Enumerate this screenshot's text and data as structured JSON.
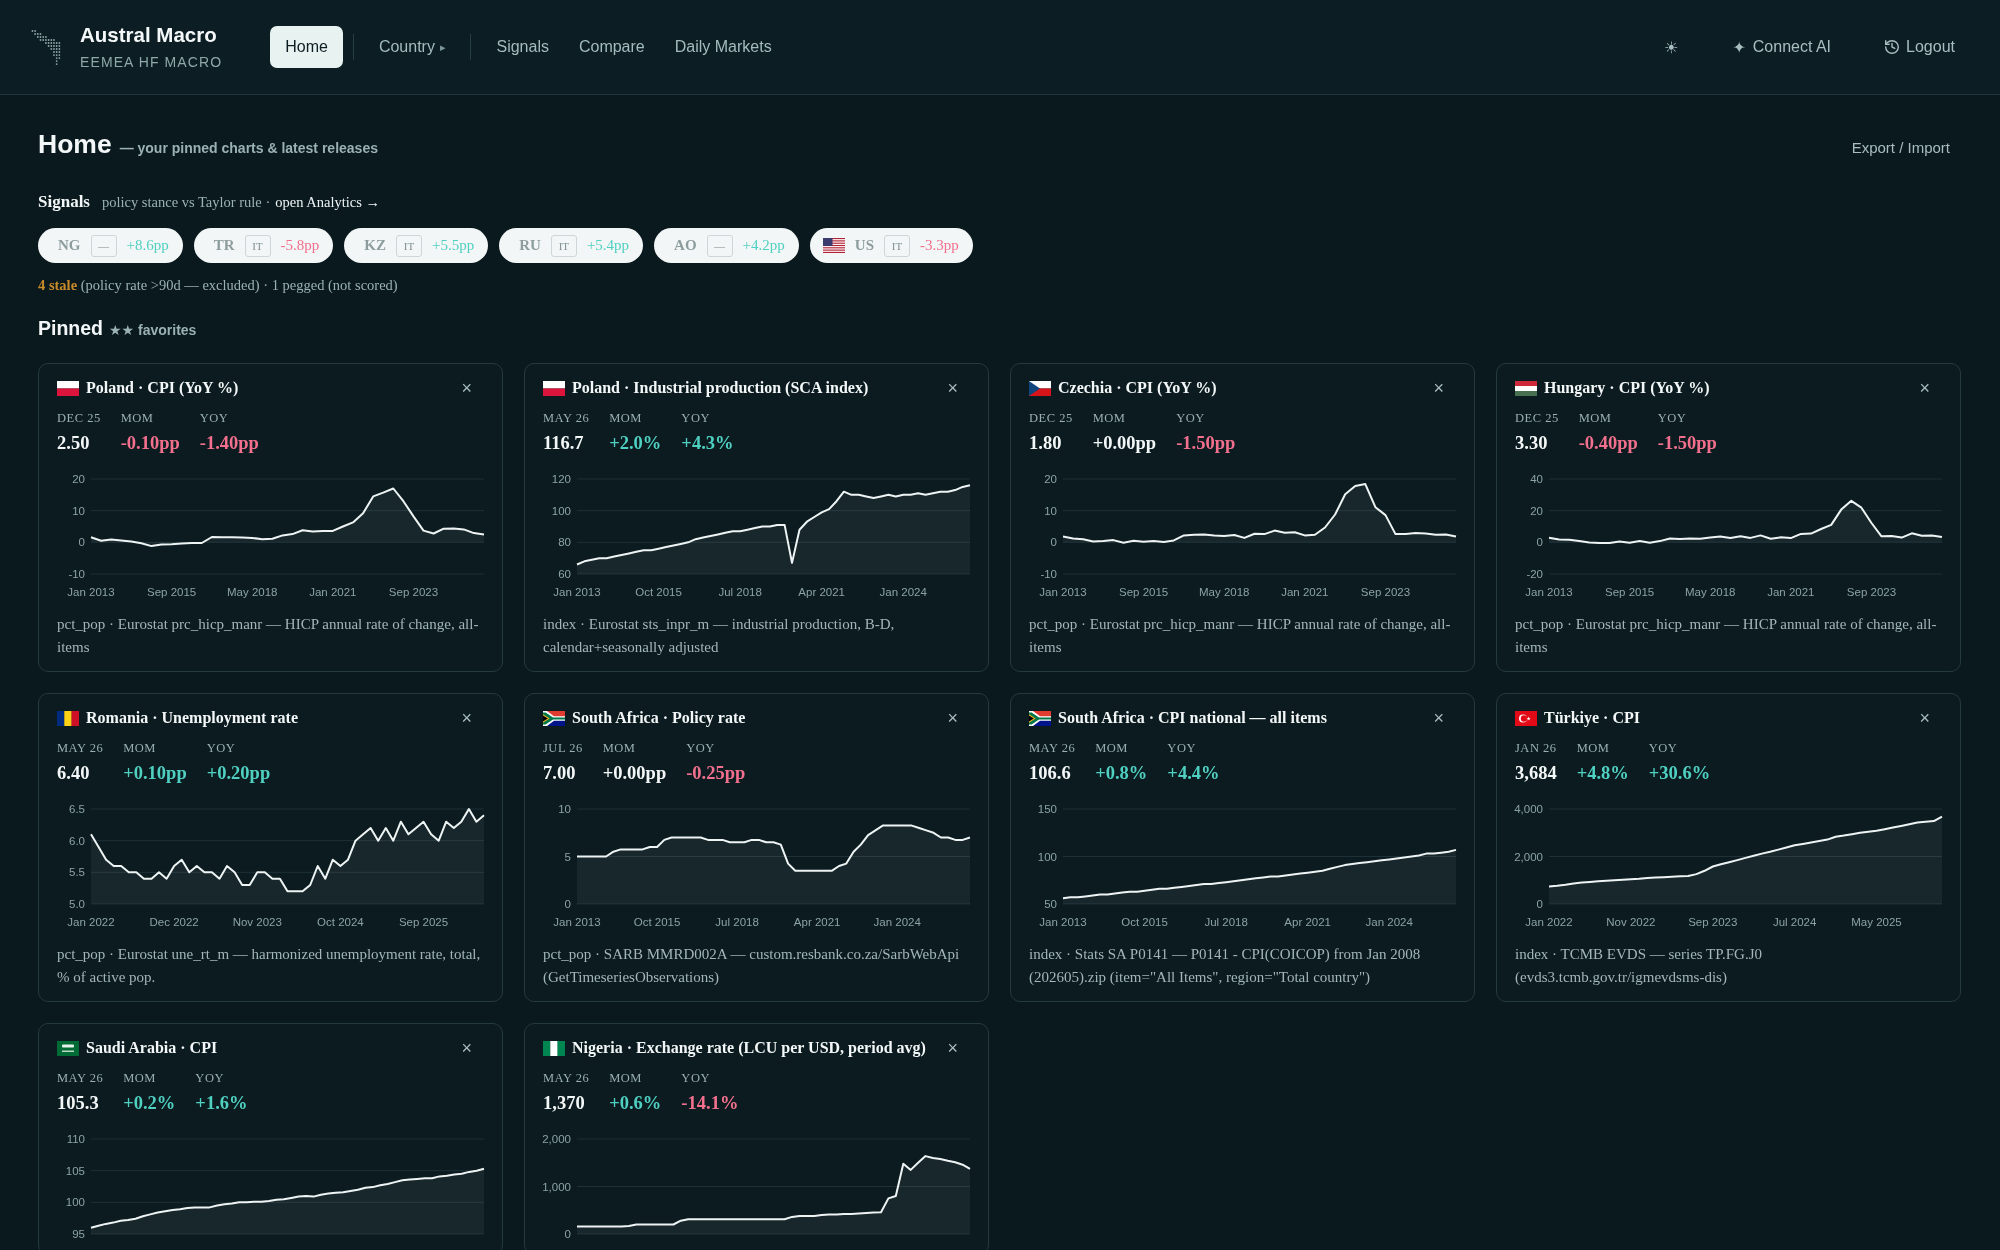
{
  "header": {
    "brand": {
      "title": "Austral Macro",
      "subtitle": "EEMEA HF MACRO"
    },
    "nav": [
      {
        "label": "Home",
        "selected": true,
        "divider": true
      },
      {
        "label": "Country",
        "caret": "▸",
        "selected": false,
        "divider": true
      },
      {
        "label": "Signals",
        "selected": false,
        "divider": false
      },
      {
        "label": "Compare",
        "selected": false,
        "divider": false
      },
      {
        "label": "Daily Markets",
        "selected": false,
        "divider": false
      }
    ],
    "actions": [
      {
        "kind": "theme",
        "glyph": "☀"
      },
      {
        "kind": "connect",
        "glyph": "✦",
        "label": "Connect AI"
      },
      {
        "kind": "logout",
        "label": "Logout"
      }
    ]
  },
  "page": {
    "title": "Home",
    "subtitle": "— your pinned charts & latest releases",
    "action": "Export / Import"
  },
  "signals": {
    "title": "Signals",
    "description": "policy stance vs Taylor rule ·",
    "link": "open Analytics →",
    "pills": [
      {
        "code": "NG",
        "regime": "—",
        "value": "+8.6pp",
        "color": "#4fd0c1"
      },
      {
        "code": "TR",
        "regime": "IT",
        "value": "-5.8pp",
        "color": "#f2708d"
      },
      {
        "code": "KZ",
        "regime": "IT",
        "value": "+5.5pp",
        "color": "#4fd0c1"
      },
      {
        "code": "RU",
        "regime": "IT",
        "value": "+5.4pp",
        "color": "#4fd0c1"
      },
      {
        "code": "AO",
        "regime": "—",
        "value": "+4.2pp",
        "color": "#4fd0c1"
      },
      {
        "flag": {
          "kind": "us"
        },
        "code": "US",
        "regime": "IT",
        "value": "-3.3pp",
        "color": "#f2708d"
      }
    ],
    "note": {
      "stale": "4 stale",
      "text": "(policy rate >90d — excluded) · 1 pegged (not scored)"
    }
  },
  "pinned": {
    "title": "Pinned",
    "subtitle": "★★ favorites"
  },
  "cards": [
    {
      "flag": {
        "kind": "pl"
      },
      "title": "Poland · CPI (YoY %)",
      "close": "×",
      "stats": [
        {
          "label": "DEC 25",
          "value": "2.50",
          "color": "#f3f7f7"
        },
        {
          "label": "MOM",
          "value": "-0.10pp",
          "color": "#f2708d"
        },
        {
          "label": "YOY",
          "value": "-1.40pp",
          "color": "#f2708d"
        }
      ],
      "chart_data": {
        "type": "area",
        "ylim": [
          -10,
          20
        ],
        "yticks": [
          -10,
          0,
          10,
          20
        ],
        "categories": [
          "Jan 2013",
          null,
          null,
          null,
          null,
          null,
          null,
          null,
          "Sep 2015",
          null,
          null,
          null,
          null,
          null,
          null,
          null,
          "May 2018",
          null,
          null,
          null,
          null,
          null,
          null,
          null,
          "Jan 2021",
          null,
          null,
          null,
          null,
          null,
          null,
          null,
          "Sep 2023",
          null,
          null,
          null,
          null,
          null,
          null,
          null
        ],
        "series": [
          {
            "color": "#eef4f4",
            "values": [
              1.6,
              0.5,
              0.9,
              0.6,
              0.3,
              -0.3,
              -1.2,
              -0.7,
              -0.6,
              -0.4,
              -0.2,
              -0.2,
              1.7,
              1.6,
              1.6,
              1.5,
              1.4,
              1.0,
              1.1,
              2.2,
              2.6,
              3.8,
              3.4,
              3.6,
              3.6,
              5.0,
              6.3,
              9.2,
              14.5,
              15.7,
              17.0,
              13.0,
              8.2,
              3.7,
              2.8,
              4.3,
              4.4,
              4.1,
              2.9,
              2.5
            ]
          }
        ]
      },
      "source": "pct_pop · Eurostat prc_hicp_manr — HICP annual rate of change, all-items"
    },
    {
      "flag": {
        "kind": "pl"
      },
      "title": "Poland · Industrial production (SCA index)",
      "close": "×",
      "stats": [
        {
          "label": "MAY 26",
          "value": "116.7",
          "color": "#f3f7f7"
        },
        {
          "label": "MOM",
          "value": "+2.0%",
          "color": "#4fd0c1"
        },
        {
          "label": "YOY",
          "value": "+4.3%",
          "color": "#4fd0c1"
        }
      ],
      "chart_data": {
        "type": "area",
        "ylim": [
          60,
          120
        ],
        "yticks": [
          60,
          80,
          100,
          120
        ],
        "categories": [
          "Jan 2013",
          null,
          null,
          null,
          null,
          null,
          null,
          null,
          null,
          null,
          null,
          "Oct 2015",
          null,
          null,
          null,
          null,
          null,
          null,
          null,
          null,
          null,
          null,
          "Jul 2018",
          null,
          null,
          null,
          null,
          null,
          null,
          null,
          null,
          null,
          null,
          "Apr 2021",
          null,
          null,
          null,
          null,
          null,
          null,
          null,
          null,
          null,
          null,
          "Jan 2024",
          null,
          null,
          null,
          null,
          null,
          null,
          null,
          null,
          null
        ],
        "series": [
          {
            "color": "#eef4f4",
            "values": [
              66,
              68,
              69,
              70,
              70,
              71,
              72,
              73,
              74,
              75,
              75,
              76,
              77,
              78,
              79,
              80,
              82,
              83,
              84,
              85,
              86,
              87,
              87,
              88,
              89,
              90,
              90,
              91,
              91,
              67,
              88,
              93,
              96,
              99,
              101,
              106,
              112,
              110,
              110,
              109,
              108,
              109,
              110,
              109,
              110,
              110,
              111,
              110,
              111,
              112,
              112,
              113,
              115,
              116
            ]
          }
        ]
      },
      "source": "index · Eurostat sts_inpr_m — industrial production, B-D, calendar+seasonally adjusted"
    },
    {
      "flag": {
        "kind": "cz"
      },
      "title": "Czechia · CPI (YoY %)",
      "close": "×",
      "stats": [
        {
          "label": "DEC 25",
          "value": "1.80",
          "color": "#f3f7f7"
        },
        {
          "label": "MOM",
          "value": "+0.00pp",
          "color": "#f3f7f7"
        },
        {
          "label": "YOY",
          "value": "-1.50pp",
          "color": "#f2708d"
        }
      ],
      "chart_data": {
        "type": "area",
        "ylim": [
          -10,
          20
        ],
        "yticks": [
          -10,
          0,
          10,
          20
        ],
        "categories": [
          "Jan 2013",
          null,
          null,
          null,
          null,
          null,
          null,
          null,
          "Sep 2015",
          null,
          null,
          null,
          null,
          null,
          null,
          null,
          "May 2018",
          null,
          null,
          null,
          null,
          null,
          null,
          null,
          "Jan 2021",
          null,
          null,
          null,
          null,
          null,
          null,
          null,
          "Sep 2023",
          null,
          null,
          null,
          null,
          null,
          null,
          null
        ],
        "series": [
          {
            "color": "#eef4f4",
            "values": [
              1.8,
              1.2,
              1.0,
              0.3,
              0.4,
              0.7,
              -0.1,
              0.5,
              0.2,
              0.4,
              0.1,
              0.6,
              2.2,
              2.4,
              2.5,
              2.2,
              2.0,
              2.3,
              1.4,
              2.7,
              2.6,
              3.7,
              3.0,
              3.2,
              2.2,
              2.4,
              4.7,
              8.8,
              15.2,
              17.8,
              18.4,
              11.1,
              8.6,
              2.6,
              2.6,
              2.9,
              2.8,
              2.4,
              2.5,
              1.8
            ]
          }
        ]
      },
      "source": "pct_pop · Eurostat prc_hicp_manr — HICP annual rate of change, all-items"
    },
    {
      "flag": {
        "kind": "hu"
      },
      "title": "Hungary · CPI (YoY %)",
      "close": "×",
      "stats": [
        {
          "label": "DEC 25",
          "value": "3.30",
          "color": "#f3f7f7"
        },
        {
          "label": "MOM",
          "value": "-0.40pp",
          "color": "#f2708d"
        },
        {
          "label": "YOY",
          "value": "-1.50pp",
          "color": "#f2708d"
        }
      ],
      "chart_data": {
        "type": "area",
        "ylim": [
          -20,
          40
        ],
        "yticks": [
          -20,
          0,
          20,
          40
        ],
        "categories": [
          "Jan 2013",
          null,
          null,
          null,
          null,
          null,
          null,
          null,
          "Sep 2015",
          null,
          null,
          null,
          null,
          null,
          null,
          null,
          "May 2018",
          null,
          null,
          null,
          null,
          null,
          null,
          null,
          "Jan 2021",
          null,
          null,
          null,
          null,
          null,
          null,
          null,
          "Sep 2023",
          null,
          null,
          null,
          null,
          null,
          null,
          null
        ],
        "series": [
          {
            "color": "#eef4f4",
            "values": [
              2.9,
              1.8,
              1.6,
              0.8,
              -0.1,
              -0.4,
              -0.5,
              0.6,
              -0.2,
              0.9,
              -0.2,
              0.8,
              2.4,
              2.1,
              2.5,
              2.3,
              3.0,
              3.6,
              2.8,
              3.9,
              2.8,
              4.4,
              2.3,
              3.2,
              2.7,
              5.3,
              5.5,
              8.4,
              11.0,
              20.7,
              26.2,
              21.9,
              12.2,
              3.8,
              4.0,
              3.0,
              5.7,
              4.2,
              4.3,
              3.3
            ]
          }
        ]
      },
      "source": "pct_pop · Eurostat prc_hicp_manr — HICP annual rate of change, all-items"
    },
    {
      "flag": {
        "kind": "ro"
      },
      "title": "Romania · Unemployment rate",
      "close": "×",
      "stats": [
        {
          "label": "MAY 26",
          "value": "6.40",
          "color": "#f3f7f7"
        },
        {
          "label": "MOM",
          "value": "+0.10pp",
          "color": "#4fd0c1"
        },
        {
          "label": "YOY",
          "value": "+0.20pp",
          "color": "#4fd0c1"
        }
      ],
      "chart_data": {
        "type": "area",
        "ylim": [
          5,
          6.5
        ],
        "yticks": [
          {
            "value": 5,
            "label": "5.0"
          },
          {
            "value": 5.5,
            "label": "5.5"
          },
          {
            "value": 6,
            "label": "6.0"
          },
          {
            "value": 6.5,
            "label": "6.5"
          }
        ],
        "categories": [
          "Jan 2022",
          null,
          null,
          null,
          null,
          null,
          null,
          null,
          null,
          null,
          null,
          "Dec 2022",
          null,
          null,
          null,
          null,
          null,
          null,
          null,
          null,
          null,
          null,
          "Nov 2023",
          null,
          null,
          null,
          null,
          null,
          null,
          null,
          null,
          null,
          null,
          "Oct 2024",
          null,
          null,
          null,
          null,
          null,
          null,
          null,
          null,
          null,
          null,
          "Sep 2025",
          null,
          null,
          null,
          null,
          null,
          null,
          null,
          null
        ],
        "series": [
          {
            "color": "#eef4f4",
            "values": [
              6.1,
              5.9,
              5.7,
              5.6,
              5.6,
              5.5,
              5.5,
              5.4,
              5.4,
              5.5,
              5.4,
              5.6,
              5.7,
              5.5,
              5.6,
              5.5,
              5.5,
              5.4,
              5.6,
              5.5,
              5.3,
              5.3,
              5.5,
              5.5,
              5.4,
              5.4,
              5.2,
              5.2,
              5.2,
              5.3,
              5.6,
              5.4,
              5.7,
              5.6,
              5.7,
              6.0,
              6.1,
              6.2,
              6.0,
              6.2,
              6.0,
              6.3,
              6.1,
              6.2,
              6.3,
              6.1,
              6.0,
              6.3,
              6.2,
              6.3,
              6.5,
              6.3,
              6.4
            ]
          }
        ]
      },
      "source": "pct_pop · Eurostat une_rt_m — harmonized unemployment rate, total, % of active pop."
    },
    {
      "flag": {
        "kind": "za"
      },
      "title": "South Africa · Policy rate",
      "close": "×",
      "stats": [
        {
          "label": "JUL 26",
          "value": "7.00",
          "color": "#f3f7f7"
        },
        {
          "label": "MOM",
          "value": "+0.00pp",
          "color": "#f3f7f7"
        },
        {
          "label": "YOY",
          "value": "-0.25pp",
          "color": "#f2708d"
        }
      ],
      "chart_data": {
        "type": "area",
        "ylim": [
          0,
          10
        ],
        "yticks": [
          0,
          5,
          10
        ],
        "categories": [
          "Jan 2013",
          null,
          null,
          null,
          null,
          null,
          null,
          null,
          null,
          null,
          null,
          "Oct 2015",
          null,
          null,
          null,
          null,
          null,
          null,
          null,
          null,
          null,
          null,
          "Jul 2018",
          null,
          null,
          null,
          null,
          null,
          null,
          null,
          null,
          null,
          null,
          "Apr 2021",
          null,
          null,
          null,
          null,
          null,
          null,
          null,
          null,
          null,
          null,
          "Jan 2024",
          null,
          null,
          null,
          null,
          null,
          null,
          null,
          null,
          null,
          null
        ],
        "series": [
          {
            "color": "#eef4f4",
            "values": [
              5,
              5,
              5,
              5,
              5,
              5.5,
              5.75,
              5.75,
              5.75,
              5.75,
              6,
              6,
              6.75,
              7,
              7,
              7,
              7,
              7,
              6.75,
              6.75,
              6.75,
              6.5,
              6.5,
              6.5,
              6.75,
              6.75,
              6.5,
              6.5,
              6.25,
              4.25,
              3.5,
              3.5,
              3.5,
              3.5,
              3.5,
              3.5,
              4,
              4.25,
              5.5,
              6.25,
              7.25,
              7.75,
              8.25,
              8.25,
              8.25,
              8.25,
              8.25,
              8,
              7.75,
              7.5,
              7,
              7,
              6.75,
              6.75,
              7
            ]
          }
        ]
      },
      "source": "pct_pop · SARB MMRD002A — custom.resbank.co.za/SarbWebApi (GetTimeseriesObservations)"
    },
    {
      "flag": {
        "kind": "za"
      },
      "title": "South Africa · CPI national — all items",
      "close": "×",
      "stats": [
        {
          "label": "MAY 26",
          "value": "106.6",
          "color": "#f3f7f7"
        },
        {
          "label": "MOM",
          "value": "+0.8%",
          "color": "#4fd0c1"
        },
        {
          "label": "YOY",
          "value": "+4.4%",
          "color": "#4fd0c1"
        }
      ],
      "chart_data": {
        "type": "area",
        "ylim": [
          50,
          150
        ],
        "yticks": [
          50,
          100,
          150
        ],
        "categories": [
          "Jan 2013",
          null,
          null,
          null,
          null,
          null,
          null,
          null,
          null,
          null,
          null,
          "Oct 2015",
          null,
          null,
          null,
          null,
          null,
          null,
          null,
          null,
          null,
          null,
          "Jul 2018",
          null,
          null,
          null,
          null,
          null,
          null,
          null,
          null,
          null,
          null,
          "Apr 2021",
          null,
          null,
          null,
          null,
          null,
          null,
          null,
          null,
          null,
          null,
          "Jan 2024",
          null,
          null,
          null,
          null,
          null,
          null,
          null,
          null,
          null
        ],
        "series": [
          {
            "color": "#eef4f4",
            "values": [
              56,
              57,
              57,
              58,
              59,
              60,
              60,
              61,
              62,
              63,
              63,
              64,
              65,
              66,
              66,
              67,
              68,
              69,
              70,
              71,
              71,
              72,
              73,
              74,
              75,
              76,
              77,
              78,
              79,
              79,
              80,
              81,
              82,
              83,
              84,
              85,
              87,
              89,
              91,
              92,
              93,
              94,
              95,
              96,
              97,
              98,
              99,
              100,
              101,
              103,
              103,
              104,
              105,
              107
            ]
          }
        ]
      },
      "source": "index · Stats SA P0141 — P0141 - CPI(COICOP) from Jan 2008 (202605).zip (item=\"All Items\", region=\"Total country\")"
    },
    {
      "flag": {
        "kind": "tr"
      },
      "title": "Türkiye · CPI",
      "close": "×",
      "stats": [
        {
          "label": "JAN 26",
          "value": "3,684",
          "color": "#f3f7f7"
        },
        {
          "label": "MOM",
          "value": "+4.8%",
          "color": "#4fd0c1"
        },
        {
          "label": "YOY",
          "value": "+30.6%",
          "color": "#4fd0c1"
        }
      ],
      "chart_data": {
        "type": "area",
        "ylim": [
          0,
          4000
        ],
        "yticks": [
          {
            "value": 0,
            "label": "0"
          },
          {
            "value": 2000,
            "label": "2,000"
          },
          {
            "value": 4000,
            "label": "4,000"
          }
        ],
        "categories": [
          "Jan 2022",
          null,
          null,
          null,
          null,
          null,
          null,
          null,
          null,
          null,
          "Nov 2022",
          null,
          null,
          null,
          null,
          null,
          null,
          null,
          null,
          null,
          "Sep 2023",
          null,
          null,
          null,
          null,
          null,
          null,
          null,
          null,
          null,
          "Jul 2024",
          null,
          null,
          null,
          null,
          null,
          null,
          null,
          null,
          null,
          "May 2025",
          null,
          null,
          null,
          null,
          null,
          null,
          null,
          null
        ],
        "series": [
          {
            "color": "#eef4f4",
            "values": [
              740,
              770,
              810,
              860,
              900,
              930,
              960,
              980,
              1000,
              1020,
              1040,
              1060,
              1090,
              1110,
              1130,
              1150,
              1170,
              1180,
              1260,
              1400,
              1580,
              1670,
              1760,
              1850,
              1940,
              2030,
              2120,
              2200,
              2290,
              2380,
              2470,
              2530,
              2590,
              2650,
              2710,
              2830,
              2880,
              2940,
              3000,
              3040,
              3080,
              3150,
              3220,
              3290,
              3360,
              3430,
              3460,
              3490,
              3680
            ]
          }
        ]
      },
      "source": "index · TCMB EVDS — series TP.FG.J0 (evds3.tcmb.gov.tr/igmevdsms-dis)"
    },
    {
      "flag": {
        "kind": "sa"
      },
      "title": "Saudi Arabia · CPI",
      "close": "×",
      "stats": [
        {
          "label": "MAY 26",
          "value": "105.3",
          "color": "#f3f7f7"
        },
        {
          "label": "MOM",
          "value": "+0.2%",
          "color": "#4fd0c1"
        },
        {
          "label": "YOY",
          "value": "+1.6%",
          "color": "#4fd0c1"
        }
      ],
      "chart_data": {
        "type": "area",
        "ylim": [
          95,
          110
        ],
        "yticks": [
          95,
          100,
          105,
          110
        ],
        "series": [
          {
            "color": "#eef4f4",
            "values": [
              96.0,
              96.3,
              96.6,
              96.8,
              97.1,
              97.2,
              97.4,
              97.8,
              98.1,
              98.4,
              98.6,
              98.8,
              98.9,
              99.1,
              99.2,
              99.2,
              99.2,
              99.5,
              99.7,
              99.8,
              100.0,
              100.0,
              100.1,
              100.1,
              100.2,
              100.4,
              100.5,
              100.7,
              100.9,
              101.0,
              100.9,
              101.2,
              101.4,
              101.5,
              101.6,
              101.8,
              102.0,
              102.3,
              102.4,
              102.7,
              102.9,
              103.2,
              103.5,
              103.6,
              103.7,
              103.8,
              103.8,
              104.1,
              104.2,
              104.4,
              104.5,
              104.8,
              105.0,
              105.3
            ]
          }
        ]
      }
    },
    {
      "flag": {
        "kind": "ng"
      },
      "title": "Nigeria · Exchange rate (LCU per USD, period avg)",
      "close": "×",
      "stats": [
        {
          "label": "MAY 26",
          "value": "1,370",
          "color": "#f3f7f7"
        },
        {
          "label": "MOM",
          "value": "+0.6%",
          "color": "#4fd0c1"
        },
        {
          "label": "YOY",
          "value": "-14.1%",
          "color": "#f2708d"
        }
      ],
      "chart_data": {
        "type": "area",
        "ylim": [
          0,
          2000
        ],
        "yticks": [
          {
            "value": 0,
            "label": "0"
          },
          {
            "value": 1000,
            "label": "1,000"
          },
          {
            "value": 2000,
            "label": "2,000"
          }
        ],
        "series": [
          {
            "color": "#eef4f4",
            "values": [
              160,
              160,
              160,
              160,
              160,
              160,
              160,
              170,
              200,
              200,
              200,
              200,
              200,
              200,
              280,
              310,
              310,
              310,
              310,
              310,
              310,
              310,
              310,
              310,
              310,
              310,
              310,
              310,
              310,
              360,
              380,
              380,
              380,
              400,
              410,
              410,
              420,
              420,
              430,
              440,
              450,
              460,
              750,
              800,
              1480,
              1350,
              1500,
              1640,
              1600,
              1580,
              1540,
              1510,
              1460,
              1370
            ]
          }
        ]
      }
    }
  ]
}
